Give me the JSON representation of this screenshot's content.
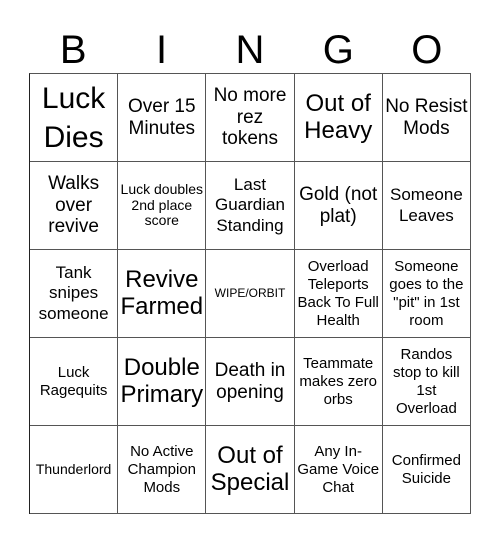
{
  "title_letters": [
    "B",
    "I",
    "N",
    "G",
    "O"
  ],
  "cells": [
    [
      "Luck Dies",
      "Over 15 Minutes",
      "No more rez tokens",
      "Out of Heavy",
      "No Resist Mods"
    ],
    [
      "Walks over revive",
      "Luck doubles 2nd place score",
      "Last Guardian Standing",
      "Gold (not plat)",
      "Someone Leaves"
    ],
    [
      "Tank snipes someone",
      "Revive Farmed",
      "WIPE/ORBIT",
      "Overload Teleports Back To Full Health",
      "Someone goes to the \"pit\" in 1st room"
    ],
    [
      "Luck Ragequits",
      "Double Primary",
      "Death in opening",
      "Teammate makes zero orbs",
      "Randos stop to kill 1st Overload"
    ],
    [
      "Thunderlord",
      "No Active Champion Mods",
      "Out of Special",
      "Any In-Game Voice Chat",
      "Confirmed Suicide"
    ]
  ]
}
